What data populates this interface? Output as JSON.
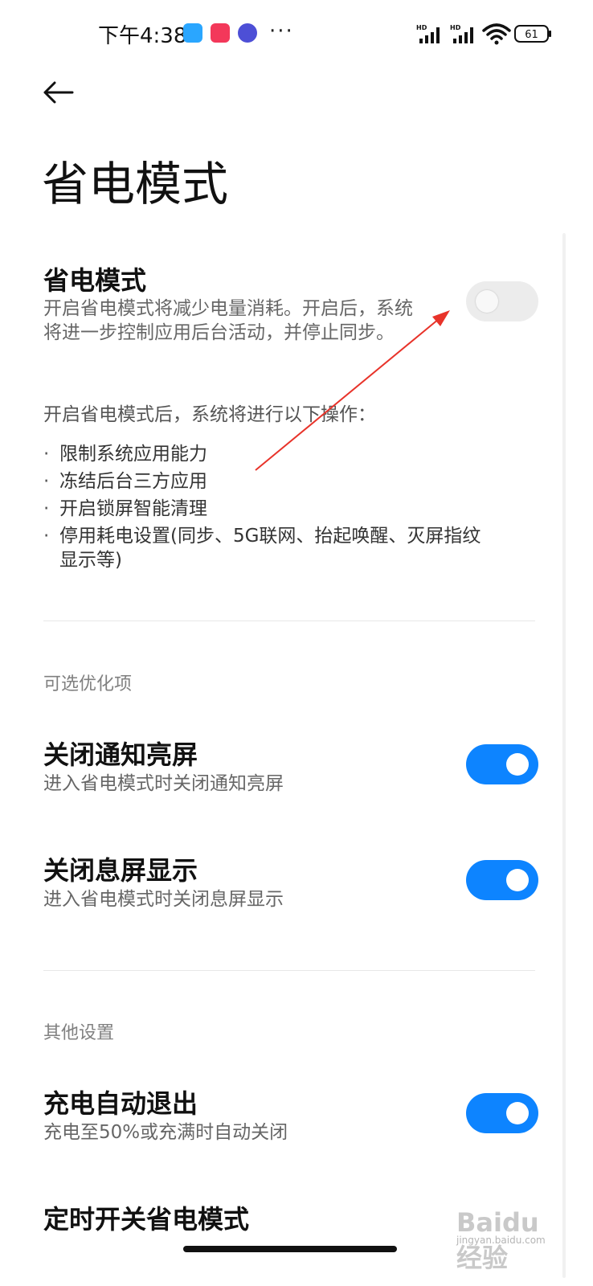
{
  "status_bar": {
    "time": "下午4:38",
    "more": "···",
    "battery": "61",
    "hd1": "HD",
    "hd2": "HD"
  },
  "header": {
    "back_icon": "back-arrow",
    "title": "省电模式"
  },
  "power_saving": {
    "title": "省电模式",
    "description_line1": "开启省电模式将减少电量消耗。开启后，系统",
    "description_line2": "将进一步控制应用后台活动，并停止同步。",
    "toggle_on": false
  },
  "operations": {
    "intro": "开启省电模式后，系统将进行以下操作：",
    "items": [
      "限制系统应用能力",
      "冻结后台三方应用",
      "开启锁屏智能清理",
      "停用耗电设置(同步、5G联网、抬起唤醒、灭屏指纹"
    ],
    "item4_cont": "显示等)"
  },
  "optional": {
    "header": "可选优化项",
    "rows": [
      {
        "title": "关闭通知亮屏",
        "subtitle": "进入省电模式时关闭通知亮屏",
        "toggle_on": true
      },
      {
        "title": "关闭息屏显示",
        "subtitle": "进入省电模式时关闭息屏显示",
        "toggle_on": true
      }
    ]
  },
  "other": {
    "header": "其他设置",
    "rows": [
      {
        "title": "充电自动退出",
        "subtitle": "充电至50%或充满时自动关闭",
        "toggle_on": true
      },
      {
        "title": "定时开关省电模式"
      }
    ]
  },
  "watermark": {
    "text": "Baidu经验",
    "sub": "jingyan.baidu.com"
  },
  "colors": {
    "accent": "#0d84ff",
    "annotation_arrow": "#e8332a"
  }
}
